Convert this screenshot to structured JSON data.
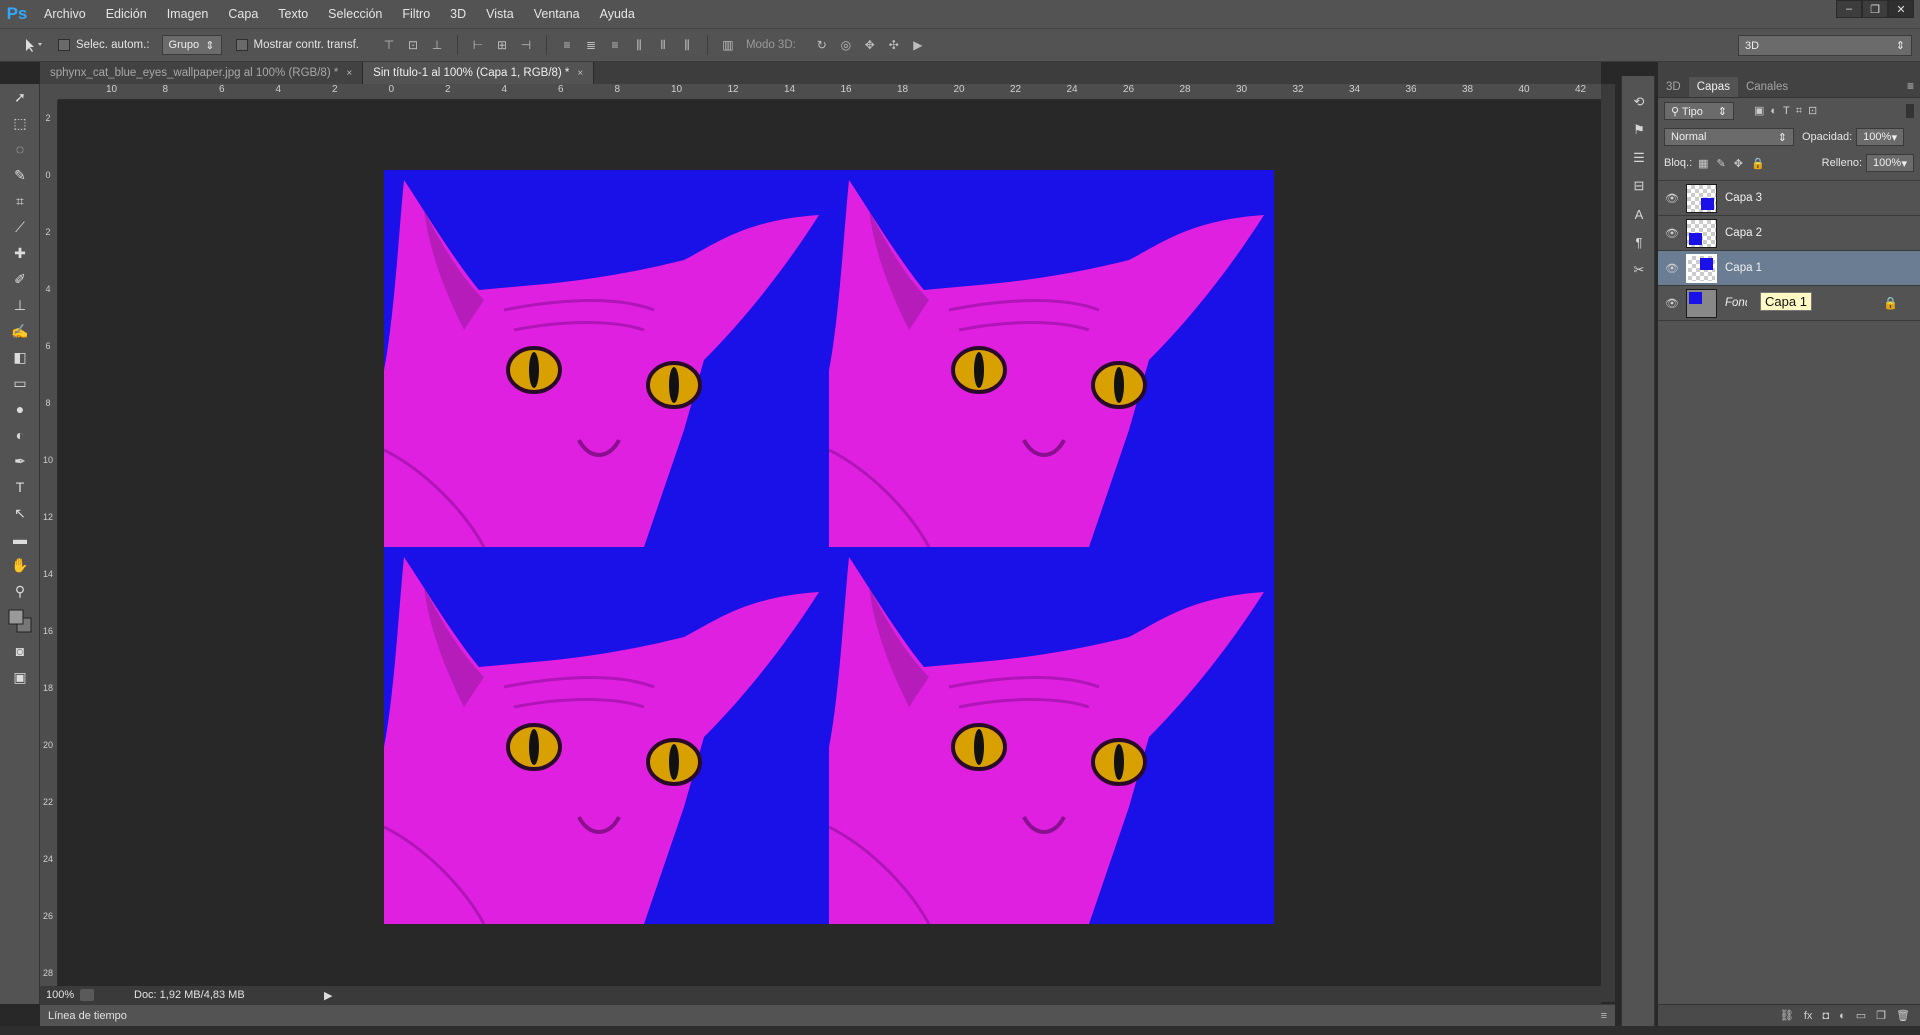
{
  "app": {
    "logo": "Ps"
  },
  "menu": [
    "Archivo",
    "Edición",
    "Imagen",
    "Capa",
    "Texto",
    "Selección",
    "Filtro",
    "3D",
    "Vista",
    "Ventana",
    "Ayuda"
  ],
  "window_controls": [
    "–",
    "❐",
    "✕"
  ],
  "options": {
    "auto_select_label": "Selec. autom.:",
    "auto_select_value": "Grupo",
    "show_transform_label": "Mostrar contr. transf.",
    "mode_3d_label": "Modo 3D:",
    "workspace": "3D"
  },
  "tabs": [
    {
      "label": "sphynx_cat_blue_eyes_wallpaper.jpg al 100% (RGB/8) *",
      "active": false
    },
    {
      "label": "Sin título-1 al 100% (Capa 1, RGB/8) *",
      "active": true
    }
  ],
  "ruler_h": [
    "10",
    "8",
    "6",
    "4",
    "2",
    "0",
    "2",
    "4",
    "6",
    "8",
    "10",
    "12",
    "14",
    "16",
    "18",
    "20",
    "22",
    "24",
    "26",
    "28",
    "30",
    "32",
    "34",
    "36",
    "38",
    "40",
    "42"
  ],
  "ruler_v": [
    "2",
    "0",
    "2",
    "4",
    "6",
    "8",
    "10",
    "12",
    "14",
    "16",
    "18",
    "20",
    "22",
    "24",
    "26",
    "28"
  ],
  "status": {
    "zoom": "100%",
    "doc": "Doc: 1,92 MB/4,83 MB"
  },
  "timeline_label": "Línea de tiempo",
  "panel": {
    "tabs": [
      "3D",
      "Capas",
      "Canales"
    ],
    "active_tab": "Capas",
    "filter": "Tipo",
    "blend_mode": "Normal",
    "opacity_label": "Opacidad:",
    "opacity_value": "100%",
    "lock_label": "Bloq.:",
    "fill_label": "Relleno:",
    "fill_value": "100%",
    "layers": [
      {
        "name": "Capa 3",
        "selected": false
      },
      {
        "name": "Capa 2",
        "selected": false
      },
      {
        "name": "Capa 1",
        "selected": true
      },
      {
        "name": "Fondo",
        "selected": false
      }
    ],
    "tooltip": "Capa 1"
  },
  "colors": {
    "canvas_bg": "#1a10e8",
    "cat": "#e020e0",
    "eye": "#d8a000",
    "selected_layer": "#6b7d93"
  }
}
